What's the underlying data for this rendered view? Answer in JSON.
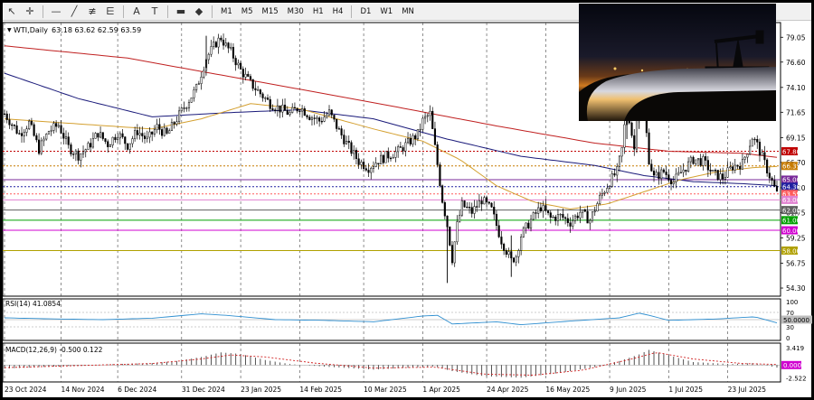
{
  "toolbar": {
    "tools": [
      {
        "name": "cursor-icon",
        "glyph": "↖"
      },
      {
        "name": "crosshair-icon",
        "glyph": "✛"
      },
      {
        "name": "horizontal-line-icon",
        "glyph": "—"
      },
      {
        "name": "trend-line-icon",
        "glyph": "╱"
      },
      {
        "name": "fibonacci-icon",
        "glyph": "≢"
      },
      {
        "name": "fibonacci-fan-icon",
        "glyph": "⋿"
      },
      {
        "name": "text-icon",
        "glyph": "A"
      },
      {
        "name": "text-label-icon",
        "glyph": "T"
      },
      {
        "name": "rectangle-icon",
        "glyph": "▬"
      },
      {
        "name": "shapes-icon",
        "glyph": "◆"
      }
    ],
    "timeframes": [
      "M1",
      "M5",
      "M15",
      "M30",
      "H1",
      "H4",
      "D1",
      "W1",
      "MN"
    ]
  },
  "chart_data": {
    "type": "candlestick",
    "title": "WTI,Daily",
    "ohlc_label": "63.18 63.62 62.59 63.59",
    "main_panel": {
      "ylim": [
        53.5,
        80.5
      ],
      "y_ticks": [
        "79.05",
        "76.60",
        "74.10",
        "71.65",
        "69.15",
        "66.70",
        "64.20",
        "61.75",
        "59.25",
        "56.75",
        "54.30"
      ],
      "x_labels": [
        "23 Oct 2024",
        "14 Nov 2024",
        "6 Dec 2024",
        "31 Dec 2024",
        "23 Jan 2025",
        "14 Feb 2025",
        "10 Mar 2025",
        "1 Apr 2025",
        "24 Apr 2025",
        "16 May 2025",
        "9 Jun 2025",
        "1 Jul 2025",
        "23 Jul 2025"
      ],
      "close_path": [
        [
          0,
          71.5
        ],
        [
          6,
          69.5
        ],
        [
          10,
          70.6
        ],
        [
          14,
          68.0
        ],
        [
          18,
          69.8
        ],
        [
          22,
          70.4
        ],
        [
          26,
          68.2
        ],
        [
          30,
          67.4
        ],
        [
          34,
          68.2
        ],
        [
          38,
          69.6
        ],
        [
          42,
          68.5
        ],
        [
          46,
          69.6
        ],
        [
          50,
          68.4
        ],
        [
          54,
          69.8
        ],
        [
          58,
          68.9
        ],
        [
          62,
          70.2
        ],
        [
          66,
          69.4
        ],
        [
          70,
          71.0
        ],
        [
          74,
          72.5
        ],
        [
          78,
          74.0
        ],
        [
          82,
          77.0
        ],
        [
          86,
          78.5
        ],
        [
          88,
          79.0
        ],
        [
          90,
          78.2
        ],
        [
          92,
          77.6
        ],
        [
          96,
          75.8
        ],
        [
          100,
          74.5
        ],
        [
          104,
          73.5
        ],
        [
          108,
          72.5
        ],
        [
          112,
          72.0
        ],
        [
          116,
          71.5
        ],
        [
          120,
          72.2
        ],
        [
          124,
          71.3
        ],
        [
          128,
          70.8
        ],
        [
          132,
          71.6
        ],
        [
          136,
          69.8
        ],
        [
          140,
          68.2
        ],
        [
          144,
          66.8
        ],
        [
          148,
          66.2
        ],
        [
          152,
          66.9
        ],
        [
          156,
          67.4
        ],
        [
          160,
          67.8
        ],
        [
          164,
          68.6
        ],
        [
          168,
          69.5
        ],
        [
          170,
          70.8
        ],
        [
          173,
          71.5
        ],
        [
          176,
          66.5
        ],
        [
          178,
          63.0
        ],
        [
          180,
          60.5
        ],
        [
          182,
          57.2
        ],
        [
          184,
          60.5
        ],
        [
          186,
          62.5
        ],
        [
          190,
          61.8
        ],
        [
          194,
          63.0
        ],
        [
          198,
          62.0
        ],
        [
          202,
          59.0
        ],
        [
          206,
          57.0
        ],
        [
          208,
          57.5
        ],
        [
          210,
          59.5
        ],
        [
          214,
          61.0
        ],
        [
          218,
          62.3
        ],
        [
          222,
          61.2
        ],
        [
          226,
          61.4
        ],
        [
          230,
          60.8
        ],
        [
          234,
          61.8
        ],
        [
          238,
          61.0
        ],
        [
          242,
          63.2
        ],
        [
          246,
          64.8
        ],
        [
          249,
          65.8
        ],
        [
          251,
          68.0
        ],
        [
          253,
          72.5
        ],
        [
          256,
          68.0
        ],
        [
          258,
          74.8
        ],
        [
          260,
          72.0
        ],
        [
          262,
          67.0
        ],
        [
          264,
          65.2
        ],
        [
          268,
          65.8
        ],
        [
          272,
          64.8
        ],
        [
          276,
          66.0
        ],
        [
          280,
          67.0
        ],
        [
          284,
          66.8
        ],
        [
          288,
          65.6
        ],
        [
          292,
          65.2
        ],
        [
          296,
          66.3
        ],
        [
          300,
          66.6
        ],
        [
          304,
          69.2
        ],
        [
          306,
          68.4
        ],
        [
          308,
          67.2
        ],
        [
          310,
          66.0
        ],
        [
          312,
          64.8
        ],
        [
          314,
          63.6
        ]
      ],
      "ma_red": [
        [
          0,
          78.2
        ],
        [
          50,
          77.0
        ],
        [
          100,
          74.8
        ],
        [
          150,
          72.6
        ],
        [
          200,
          70.3
        ],
        [
          240,
          68.6
        ],
        [
          270,
          67.8
        ],
        [
          300,
          67.6
        ],
        [
          314,
          67.2
        ]
      ],
      "ma_navy": [
        [
          0,
          75.5
        ],
        [
          30,
          73.0
        ],
        [
          60,
          71.2
        ],
        [
          90,
          71.6
        ],
        [
          120,
          71.9
        ],
        [
          150,
          71.0
        ],
        [
          180,
          69.0
        ],
        [
          210,
          67.3
        ],
        [
          240,
          66.4
        ],
        [
          260,
          65.4
        ],
        [
          280,
          64.8
        ],
        [
          300,
          64.6
        ],
        [
          314,
          64.4
        ]
      ],
      "ma_gold": [
        [
          0,
          71.0
        ],
        [
          30,
          70.5
        ],
        [
          60,
          70.0
        ],
        [
          80,
          71.0
        ],
        [
          100,
          72.5
        ],
        [
          120,
          72.0
        ],
        [
          150,
          70.0
        ],
        [
          170,
          68.8
        ],
        [
          185,
          67.0
        ],
        [
          200,
          64.4
        ],
        [
          215,
          62.8
        ],
        [
          230,
          62.1
        ],
        [
          245,
          62.6
        ],
        [
          260,
          63.8
        ],
        [
          275,
          65.0
        ],
        [
          290,
          65.8
        ],
        [
          305,
          66.2
        ],
        [
          314,
          66.3
        ]
      ],
      "h_levels": [
        {
          "label": "67.80",
          "value": 67.8,
          "color": "#c00000",
          "style": "dotted"
        },
        {
          "label": "66.35",
          "value": 66.35,
          "color": "#c67a00",
          "style": "dotted"
        },
        {
          "label": "65.00",
          "value": 65.0,
          "color": "#7a2a9a",
          "style": "solid"
        },
        {
          "label": "64.30",
          "value": 64.3,
          "color": "#2020a0",
          "style": "dotted"
        },
        {
          "label": "63.59",
          "value": 63.59,
          "color": "#ff5a5a",
          "style": "dotted"
        },
        {
          "label": "63.00",
          "value": 63.0,
          "color": "#e080d0",
          "style": "solid"
        },
        {
          "label": "62.00",
          "value": 62.0,
          "color": "#606060",
          "style": "solid"
        },
        {
          "label": "61.00",
          "value": 61.0,
          "color": "#00a000",
          "style": "solid"
        },
        {
          "label": "60.00",
          "value": 60.0,
          "color": "#d000d0",
          "style": "solid"
        },
        {
          "label": "58.00",
          "value": 58.0,
          "color": "#b0a000",
          "style": "solid"
        }
      ]
    },
    "rsi_panel": {
      "title": "RSI(14) 41.0854",
      "ylim": [
        0,
        100
      ],
      "y_ticks": [
        "100",
        "70",
        "30",
        "0"
      ],
      "level_label": "50.0000",
      "level_value": 50,
      "values": [
        [
          0,
          55
        ],
        [
          20,
          52
        ],
        [
          40,
          50
        ],
        [
          60,
          54
        ],
        [
          80,
          66
        ],
        [
          90,
          62
        ],
        [
          110,
          50
        ],
        [
          130,
          48
        ],
        [
          150,
          44
        ],
        [
          170,
          60
        ],
        [
          176,
          62
        ],
        [
          182,
          38
        ],
        [
          200,
          44
        ],
        [
          210,
          36
        ],
        [
          230,
          46
        ],
        [
          250,
          55
        ],
        [
          258,
          68
        ],
        [
          262,
          62
        ],
        [
          270,
          48
        ],
        [
          290,
          52
        ],
        [
          305,
          58
        ],
        [
          314,
          41
        ]
      ]
    },
    "macd_panel": {
      "title": "MACD(12,26,9) -0.500 0.122",
      "ylim": [
        -2.8,
        3.8
      ],
      "y_ticks": [
        "3.419",
        "-2.522"
      ],
      "level_label": "0.000",
      "level_value": 0,
      "histogram": [
        [
          0,
          -0.7
        ],
        [
          20,
          -0.3
        ],
        [
          40,
          0.1
        ],
        [
          60,
          0.4
        ],
        [
          70,
          0.8
        ],
        [
          80,
          1.6
        ],
        [
          88,
          2.5
        ],
        [
          96,
          2.2
        ],
        [
          106,
          1.0
        ],
        [
          116,
          0.2
        ],
        [
          130,
          -0.3
        ],
        [
          150,
          -0.9
        ],
        [
          165,
          -0.5
        ],
        [
          175,
          -0.3
        ],
        [
          182,
          -1.2
        ],
        [
          195,
          -2.2
        ],
        [
          210,
          -2.5
        ],
        [
          225,
          -1.6
        ],
        [
          240,
          -0.4
        ],
        [
          250,
          0.8
        ],
        [
          258,
          2.1
        ],
        [
          262,
          3.0
        ],
        [
          268,
          2.2
        ],
        [
          280,
          0.6
        ],
        [
          295,
          0.2
        ],
        [
          305,
          0.4
        ],
        [
          314,
          -0.5
        ]
      ],
      "signal": [
        [
          0,
          -0.5
        ],
        [
          30,
          -0.1
        ],
        [
          60,
          0.3
        ],
        [
          80,
          1.2
        ],
        [
          92,
          2.0
        ],
        [
          106,
          1.6
        ],
        [
          126,
          0.4
        ],
        [
          150,
          -0.6
        ],
        [
          175,
          -0.4
        ],
        [
          195,
          -1.8
        ],
        [
          215,
          -2.0
        ],
        [
          235,
          -1.0
        ],
        [
          255,
          1.2
        ],
        [
          265,
          2.5
        ],
        [
          280,
          1.2
        ],
        [
          300,
          0.3
        ],
        [
          314,
          0.122
        ]
      ]
    }
  }
}
